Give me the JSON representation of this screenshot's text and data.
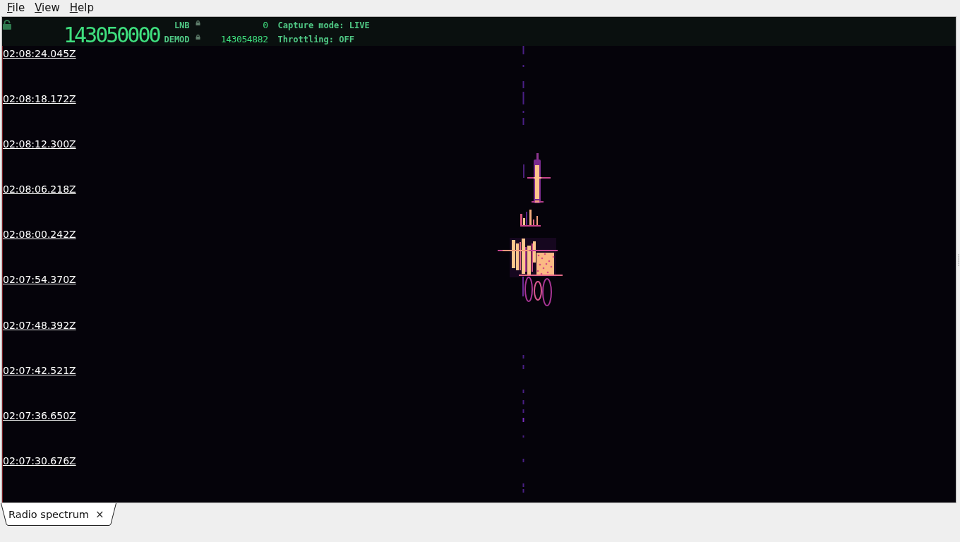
{
  "menu": [
    {
      "label": "File"
    },
    {
      "label": "View"
    },
    {
      "label": "Help"
    }
  ],
  "header": {
    "frequency": "143050000",
    "rows": [
      {
        "label": "LNB",
        "value": "0",
        "status": "Capture mode: LIVE"
      },
      {
        "label": "DEMOD",
        "value": "143054882",
        "status": "Throttling: OFF"
      }
    ]
  },
  "waterfall": {
    "timestamps": [
      "02:08:24.045Z",
      "02:08:18.172Z",
      "02:08:12.300Z",
      "02:08:06.218Z",
      "02:08:00.242Z",
      "02:07:54.370Z",
      "02:07:48.392Z",
      "02:07:42.521Z",
      "02:07:36.650Z",
      "02:07:30.676Z"
    ]
  },
  "tabs": [
    {
      "label": "Radio spectrum",
      "close": "×",
      "selected": true
    }
  ]
}
